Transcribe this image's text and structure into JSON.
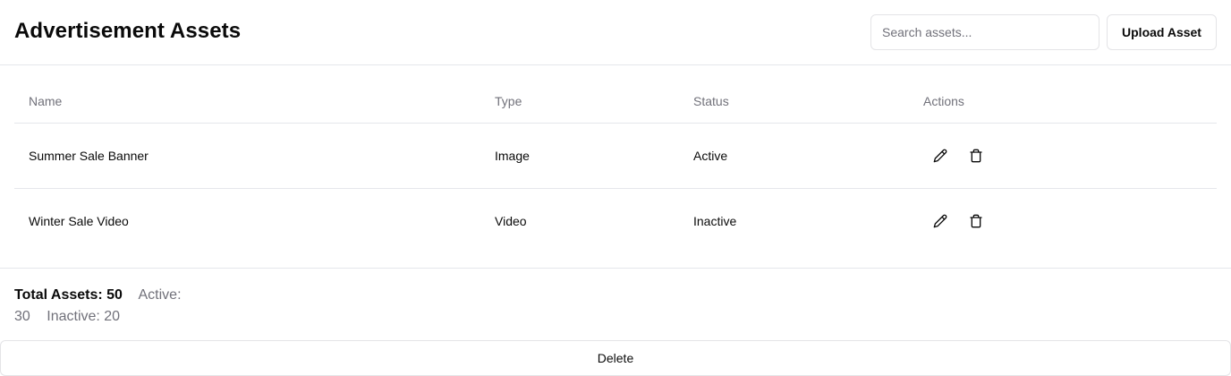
{
  "header": {
    "title": "Advertisement Assets",
    "search_placeholder": "Search assets...",
    "upload_label": "Upload Asset"
  },
  "table": {
    "columns": [
      "Name",
      "Type",
      "Status",
      "Actions"
    ],
    "rows": [
      {
        "name": "Summer Sale Banner",
        "type": "Image",
        "status": "Active",
        "actions": [
          "edit-icon",
          "trash-icon"
        ]
      },
      {
        "name": "Winter Sale Video",
        "type": "Video",
        "status": "Inactive",
        "actions": [
          "edit-icon",
          "trash-icon"
        ]
      }
    ]
  },
  "summary": {
    "total_label": "Total Assets: 50",
    "active_label": "Active: 30",
    "inactive_label": "Inactive: 20"
  },
  "footer": {
    "delete_label": "Delete"
  }
}
